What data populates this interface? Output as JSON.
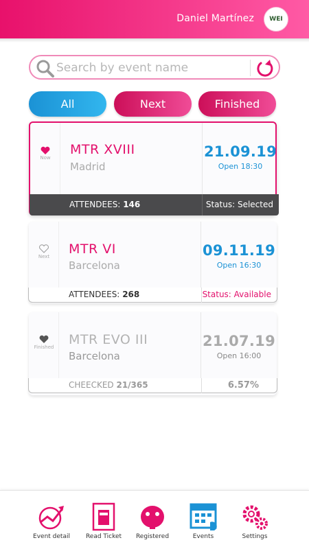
{
  "header": {
    "user_name": "Daniel Martínez",
    "logo_text": "WEI",
    "color": "#e8116b"
  },
  "search": {
    "placeholder": "Search by event name",
    "value": ""
  },
  "filters": [
    {
      "label": "All",
      "color": "#1b92d5",
      "active": true
    },
    {
      "label": "Next",
      "color": "#cc0f59",
      "active": false
    },
    {
      "label": "Finished",
      "color": "#cc0f59",
      "active": false
    }
  ],
  "events": [
    {
      "state": "Now",
      "icon": "heart-filled-icon",
      "title": "MTR XVIII",
      "city": "Madrid",
      "date": "21.09.19",
      "open": "Open 18:30",
      "footer_label": "ATTENDEES:",
      "footer_value": "146",
      "status_label": "Status:",
      "status_value": "Selected",
      "selected": true
    },
    {
      "state": "Next",
      "icon": "heart-outline-icon",
      "title": "MTR VI",
      "city": "Barcelona",
      "date": "09.11.19",
      "open": "Open 16:30",
      "footer_label": "ATTENDEES:",
      "footer_value": "268",
      "status_label": "Status:",
      "status_value": "Available",
      "selected": false
    },
    {
      "state": "Finished",
      "icon": "heart-filled-icon",
      "title": "MTR EVO III",
      "city": "Barcelona",
      "date": "21.07.19",
      "open": "Open 16:00",
      "footer_label": "CHEECKED",
      "footer_value": "21/365",
      "percent": "6.57%",
      "selected": false
    }
  ],
  "nav": [
    {
      "label": "Event detail",
      "icon": "event-detail-icon"
    },
    {
      "label": "Read Ticket",
      "icon": "read-ticket-icon"
    },
    {
      "label": "Registered",
      "icon": "registered-icon"
    },
    {
      "label": "Events",
      "icon": "events-calendar-icon",
      "active": true
    },
    {
      "label": "Settings",
      "icon": "settings-gears-icon"
    }
  ],
  "colors": {
    "pink": "#e3106c",
    "blue": "#1b92d5",
    "grey": "#aaaaaa"
  }
}
